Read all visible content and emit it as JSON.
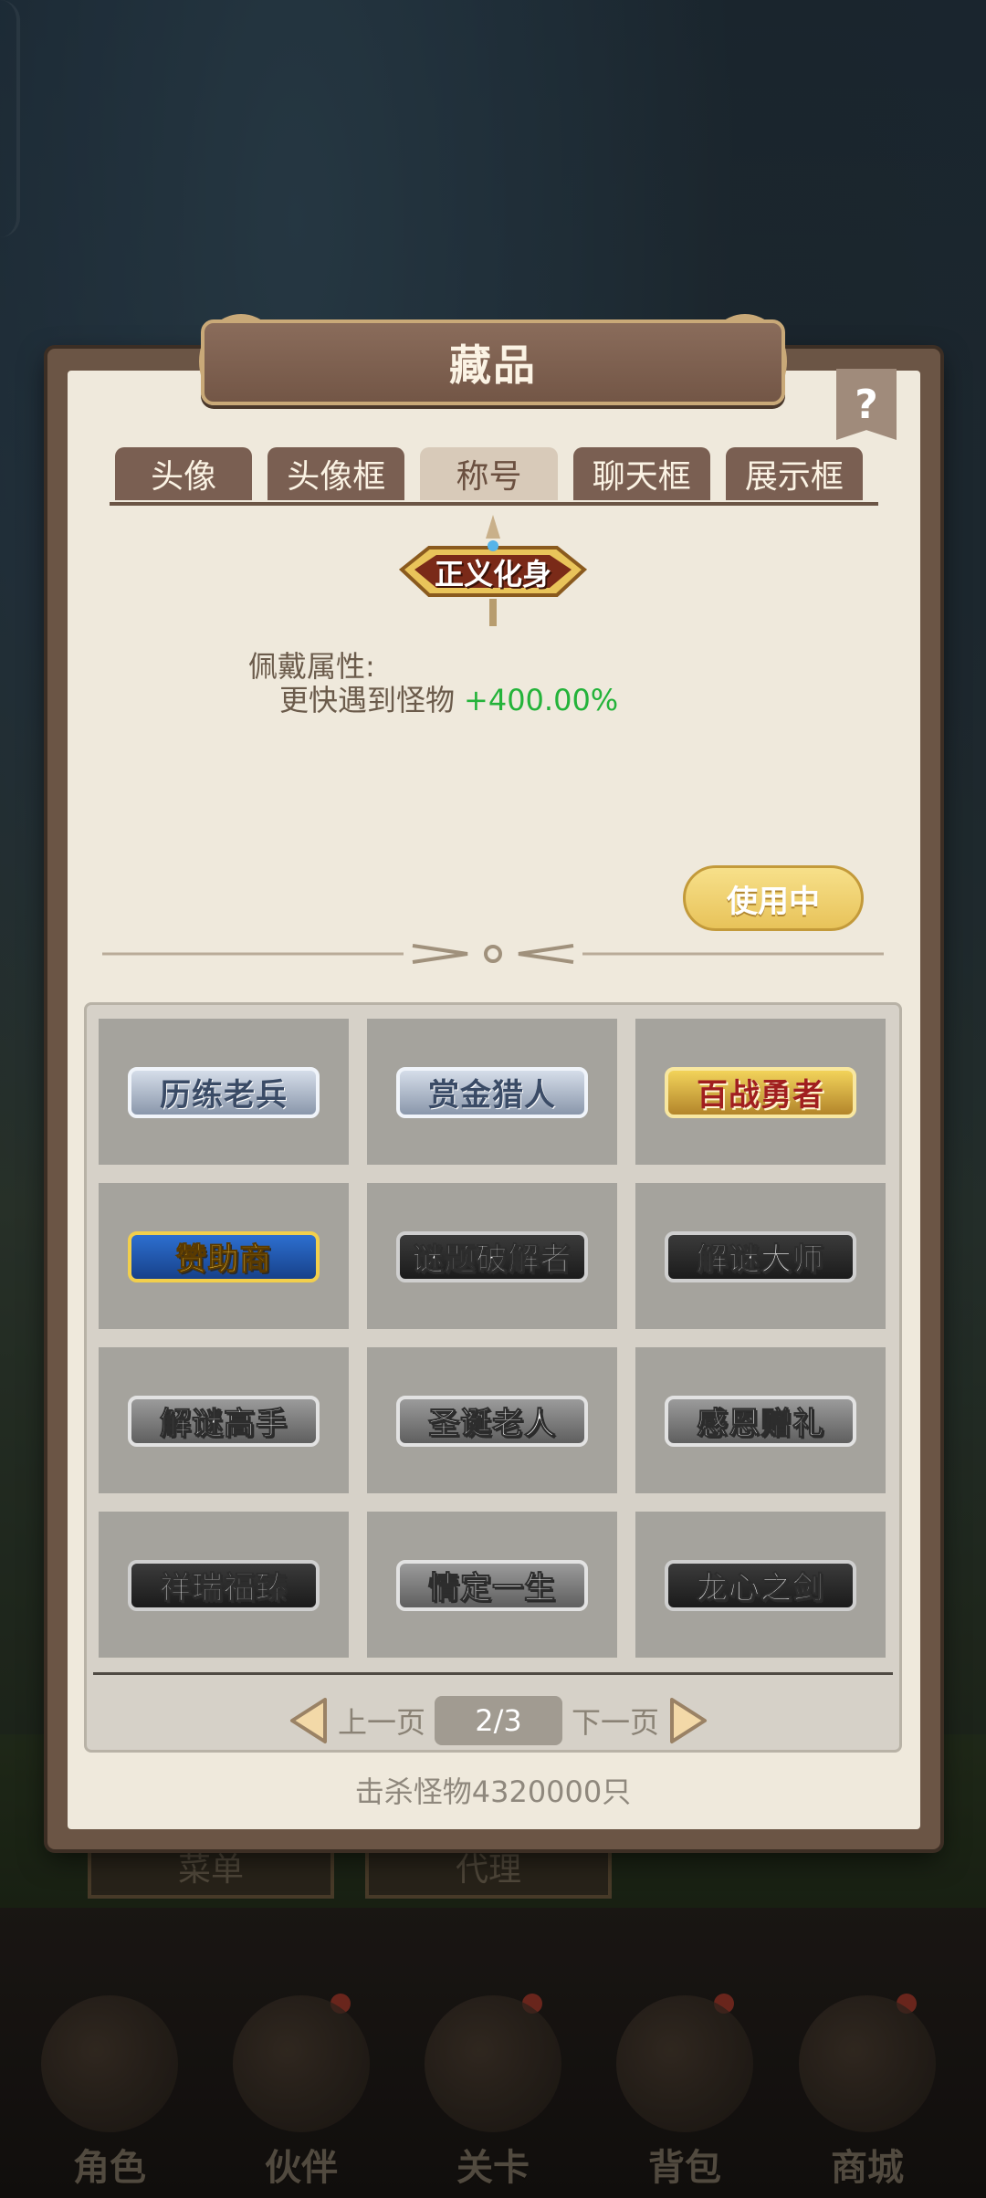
{
  "background": {
    "buttons": [
      "菜单",
      "代理"
    ],
    "nav": [
      {
        "label": "角色",
        "badge": false
      },
      {
        "label": "伙伴",
        "badge": true
      },
      {
        "label": "关卡",
        "badge": true
      },
      {
        "label": "背包",
        "badge": true
      },
      {
        "label": "商城",
        "badge": true
      }
    ]
  },
  "dialog": {
    "title": "藏品",
    "help_label": "?",
    "tabs": [
      {
        "label": "头像",
        "active": false
      },
      {
        "label": "头像框",
        "active": false
      },
      {
        "label": "称号",
        "active": true
      },
      {
        "label": "聊天框",
        "active": false
      },
      {
        "label": "展示框",
        "active": false
      }
    ],
    "selected": {
      "badge_text": "正义化身",
      "prop_label": "佩戴属性:",
      "prop_name": "更快遇到怪物",
      "prop_value": "+400.00%",
      "use_button": "使用中"
    },
    "titles": [
      {
        "text": "历练老兵",
        "style": "silver"
      },
      {
        "text": "赏金猎人",
        "style": "silver"
      },
      {
        "text": "百战勇者",
        "style": "gold"
      },
      {
        "text": "赞助商",
        "style": "gold2"
      },
      {
        "text": "谜题破解者",
        "style": "dark"
      },
      {
        "text": "解谜大师",
        "style": "dark"
      },
      {
        "text": "解谜高手",
        "style": "gray"
      },
      {
        "text": "圣诞老人",
        "style": "gray"
      },
      {
        "text": "感恩赠礼",
        "style": "gray"
      },
      {
        "text": "祥瑞福臻",
        "style": "dark"
      },
      {
        "text": "情定一生",
        "style": "gray"
      },
      {
        "text": "龙心之剑",
        "style": "dark"
      }
    ],
    "pager": {
      "prev_label": "上一页",
      "next_label": "下一页",
      "page": "2/3"
    },
    "footer": "击杀怪物4320000只"
  },
  "colors": {
    "accent_green": "#24b33a",
    "tab_active": "#d8cab9",
    "tab_inactive": "#7a5f52"
  }
}
